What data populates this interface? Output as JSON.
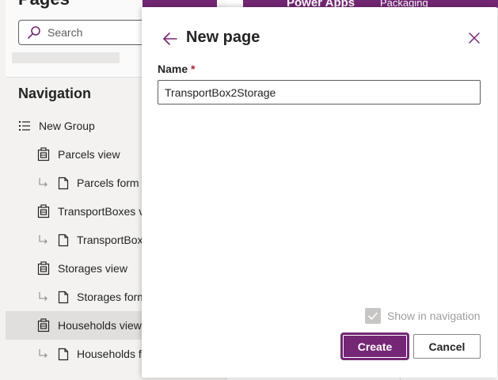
{
  "left_panel": {
    "title": "Pages",
    "search_placeholder": "Search",
    "navigation_title": "Navigation",
    "items": [
      {
        "type": "group",
        "label": "New Group"
      },
      {
        "type": "view",
        "label": "Parcels view"
      },
      {
        "type": "form",
        "label": "Parcels form"
      },
      {
        "type": "view",
        "label": "TransportBoxes vi"
      },
      {
        "type": "form",
        "label": "TransportBox"
      },
      {
        "type": "view",
        "label": "Storages view"
      },
      {
        "type": "form",
        "label": "Storages form"
      },
      {
        "type": "view",
        "label": "Households view",
        "selected": true
      },
      {
        "type": "form",
        "label": "Households f"
      }
    ]
  },
  "header": {
    "app_name": "Power Apps",
    "app_sub": "Packaging"
  },
  "dialog": {
    "title": "New page",
    "name_label": "Name",
    "required_marker": "*",
    "name_value": "TransportBox2Storage",
    "show_in_navigation_label": "Show in navigation",
    "show_in_navigation_checked": true,
    "create_label": "Create",
    "cancel_label": "Cancel"
  },
  "colors": {
    "accent": "#742774",
    "required": "#a4262c"
  }
}
